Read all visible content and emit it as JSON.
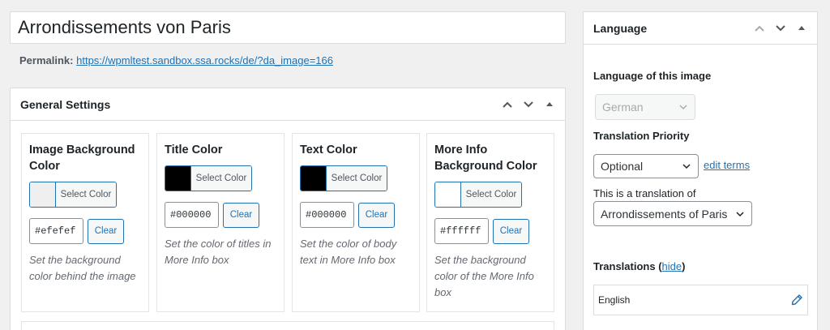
{
  "post": {
    "title": "Arrondissements von Paris",
    "permalink_label": "Permalink:",
    "permalink_url": "https://wpmltest.sandbox.ssa.rocks/de/?da_image=166"
  },
  "general_settings": {
    "title": "General Settings",
    "cards": [
      {
        "title": "Image Background Color",
        "select_label": "Select Color",
        "hex": "#efefef",
        "swatch": "#efefef",
        "clear_label": "Clear",
        "description": "Set the background color behind the image"
      },
      {
        "title": "Title Color",
        "select_label": "Select Color",
        "hex": "#000000",
        "swatch": "#000000",
        "clear_label": "Clear",
        "description": "Set the color of titles in More Info box"
      },
      {
        "title": "Text Color",
        "select_label": "Select Color",
        "hex": "#000000",
        "swatch": "#000000",
        "clear_label": "Clear",
        "description": "Set the color of body text in More Info box"
      },
      {
        "title": "More Info Background Color",
        "select_label": "Select Color",
        "hex": "#ffffff",
        "swatch": "#ffffff",
        "clear_label": "Clear",
        "description": "Set the background color of the More Info box"
      }
    ]
  },
  "language_box": {
    "title": "Language",
    "language_label": "Language of this image",
    "language_value": "German",
    "priority_label": "Translation Priority",
    "priority_value": "Optional",
    "edit_terms": "edit terms",
    "translation_of_label": "This is a translation of",
    "translation_of_value": "Arrondissements of Paris",
    "translations_label": "Translations",
    "hide_link": "hide",
    "translations": [
      {
        "language": "English"
      }
    ]
  },
  "colors": {
    "link": "#2271b1",
    "border": "#dcdcde",
    "background": "#f0f0f1"
  }
}
